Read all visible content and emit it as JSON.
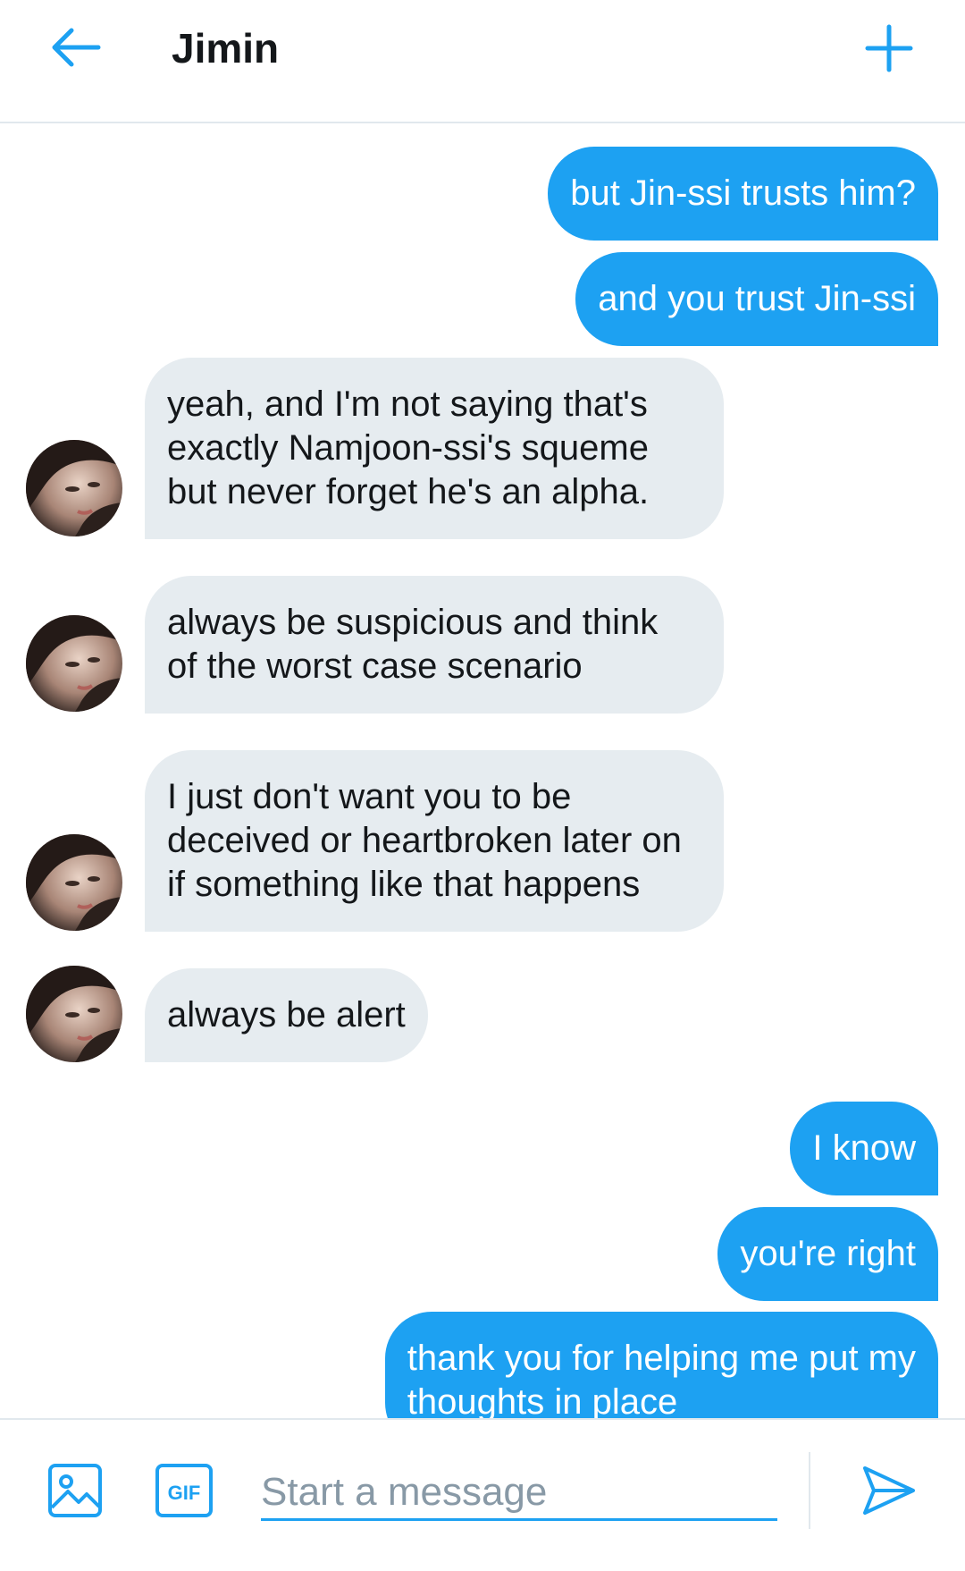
{
  "header": {
    "title": "Jimin",
    "back_icon": "arrow-left-icon",
    "add_icon": "plus-icon"
  },
  "colors": {
    "accent": "#1da1f2",
    "received_bubble": "#e6ecf0",
    "text_dark": "#14171a",
    "placeholder": "#8899a6"
  },
  "messages": [
    {
      "sender": "me",
      "lines": [
        "but Jin-ssi trusts him?"
      ]
    },
    {
      "sender": "me",
      "lines": [
        "and you trust Jin-ssi"
      ]
    },
    {
      "sender": "Jimin",
      "lines": [
        "yeah, and I'm not saying that's",
        "exactly Namjoon-ssi's squeme",
        "but never forget he's an alpha."
      ]
    },
    {
      "sender": "Jimin",
      "lines": [
        "always be suspicious and think",
        "of the worst case scenario"
      ]
    },
    {
      "sender": "Jimin",
      "lines": [
        "I just don't want you to be",
        "deceived or heartbroken later on",
        "if something like that happens"
      ]
    },
    {
      "sender": "Jimin",
      "lines": [
        "always be alert"
      ]
    },
    {
      "sender": "me",
      "lines": [
        "I know"
      ]
    },
    {
      "sender": "me",
      "lines": [
        "you're right"
      ]
    },
    {
      "sender": "me",
      "lines": [
        "thank you for helping me put my",
        "thoughts in place"
      ]
    }
  ],
  "composer": {
    "placeholder": "Start a message",
    "value": "",
    "image_icon": "image-icon",
    "gif_icon": "gif-icon",
    "gif_label": "GIF",
    "send_icon": "send-icon"
  }
}
